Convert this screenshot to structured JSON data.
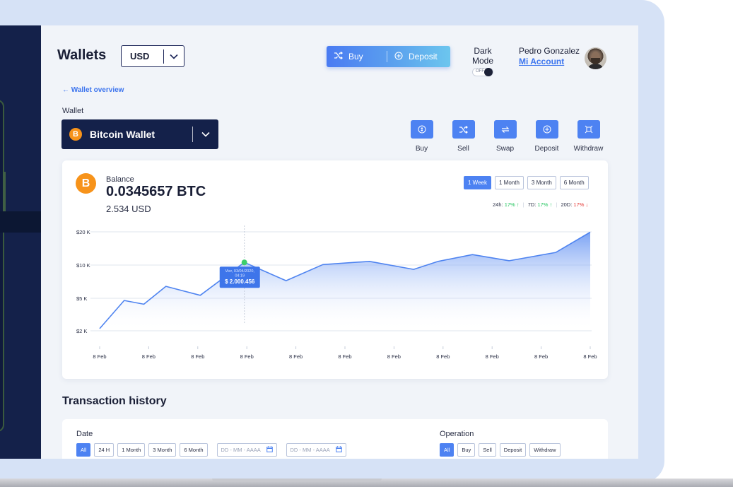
{
  "header": {
    "title": "Wallets",
    "currency": "USD",
    "buy_label": "Buy",
    "deposit_label": "Deposit",
    "dark_mode_label": "Dark Mode",
    "toggle_state": "OFF",
    "user_name": "Pedro Gonzalez",
    "account_link": "Mi Account"
  },
  "nav": {
    "back_link": "← Wallet overview",
    "wallet_label": "Wallet",
    "wallet_selected": "Bitcoin Wallet",
    "wallet_symbol": "B"
  },
  "actions": [
    {
      "label": "Buy",
      "icon": "coin-icon"
    },
    {
      "label": "Sell",
      "icon": "shuffle-icon"
    },
    {
      "label": "Swap",
      "icon": "swap-icon"
    },
    {
      "label": "Deposit",
      "icon": "plus-circle-icon"
    },
    {
      "label": "Withdraw",
      "icon": "withdraw-icon"
    }
  ],
  "balance": {
    "label": "Balance",
    "amount": "0.0345657 BTC",
    "usd": "2.534 USD",
    "periods": [
      "1 Week",
      "1 Month",
      "3 Month",
      "6 Month"
    ],
    "active_period": "1 Week",
    "changes": {
      "h24_label": "24h:",
      "h24_value": "17% ↑",
      "d7_label": "7D:",
      "d7_value": "17% ↑",
      "d20_label": "20D:",
      "d20_value": "17% ↓"
    }
  },
  "chart_data": {
    "type": "area",
    "y_ticks": [
      {
        "label": "$20 K",
        "value": 20000
      },
      {
        "label": "$10 K",
        "value": 10000
      },
      {
        "label": "$5 K",
        "value": 5000
      },
      {
        "label": "$2 K",
        "value": 2000
      }
    ],
    "x_ticks": [
      "8 Feb",
      "8 Feb",
      "8 Feb",
      "8 Feb",
      "8 Feb",
      "8 Feb",
      "8 Feb",
      "8 Feb",
      "8 Feb",
      "8 Feb",
      "8 Feb"
    ],
    "series": [
      {
        "x": [
          0,
          0.5,
          0.9,
          1.35,
          2.05,
          2.95,
          3.8,
          4.55,
          5.5,
          6.4,
          6.9,
          7.6,
          8.35,
          9.3,
          10.0
        ],
        "values": [
          2200,
          4800,
          4450,
          6800,
          5450,
          10800,
          7650,
          10150,
          11100,
          9350,
          11100,
          13150,
          11300,
          13800,
          19900
        ]
      }
    ],
    "tooltip": {
      "date": "Vier, 03/04/2020,",
      "time": "04:19",
      "value": "$ 2.000.456",
      "index": 5
    },
    "colors": {
      "line": "#4f84f0",
      "fill_top": "#4f84f0",
      "fill_bottom": "#ffffff",
      "marker": "#3ecf6b",
      "tooltip_bg": "#3e75ea"
    }
  },
  "transactions": {
    "title": "Transaction history",
    "date_label": "Date",
    "date_filters": [
      "All",
      "24 H",
      "1 Month",
      "3 Month",
      "6 Month"
    ],
    "date_active": "All",
    "date_from_placeholder": "DD - MM - AAAA",
    "date_to_placeholder": "DD - MM - AAAA",
    "operation_label": "Operation",
    "operation_filters": [
      "All",
      "Buy",
      "Sell",
      "Deposit",
      "Withdraw"
    ],
    "operation_active": "All"
  }
}
